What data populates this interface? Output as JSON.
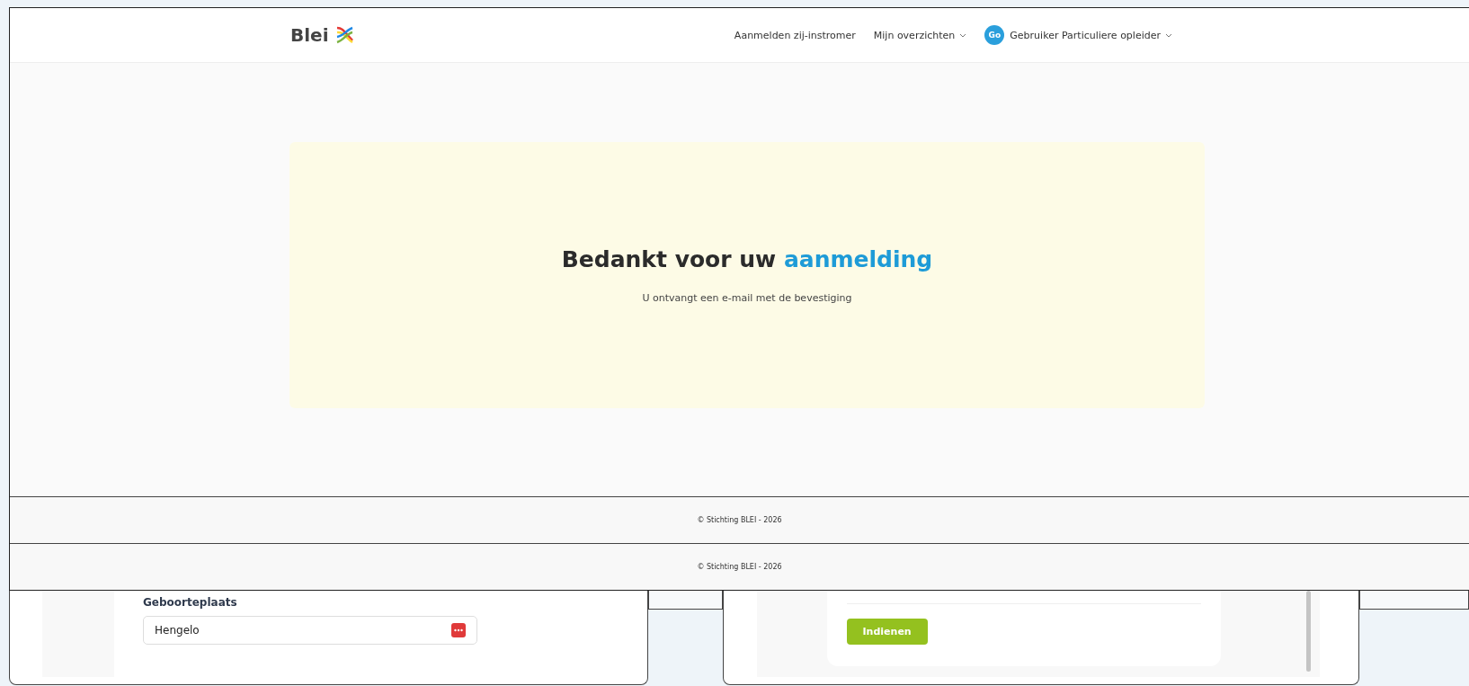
{
  "header": {
    "logo": "Blei",
    "nav": [
      {
        "label": "Aanmelden zij-instromer",
        "dropdown": false
      },
      {
        "label": "Mijn overzichten",
        "dropdown": true
      }
    ],
    "user": {
      "initials": "Go",
      "name": "Gebruiker Particuliere opleider",
      "dropdown": true
    }
  },
  "confirmation": {
    "heading": "Bedankt voor uw",
    "heading_highlight": "aanmelding",
    "message": "U ontvangt een e-mail met de bevestiging"
  },
  "footers": [
    "© Stichting BLEI - 2026",
    "© Stichting BLEI - 2026"
  ],
  "form_window": {
    "label": "Geboorteplaats",
    "value": "Hengelo"
  },
  "submit_window": {
    "button": "Indienen"
  }
}
